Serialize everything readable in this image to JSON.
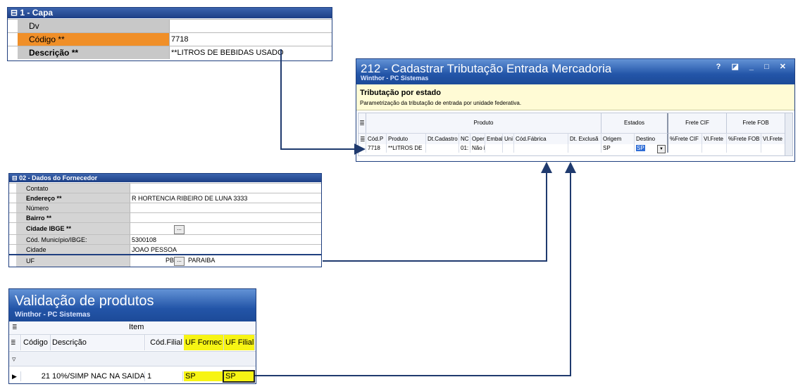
{
  "capa": {
    "header": "1 - Capa",
    "rows": [
      {
        "label": "Dv",
        "value": ""
      },
      {
        "label": "Código **",
        "value": "7718"
      },
      {
        "label": "Descrição **",
        "value": "**LITROS DE BEBIDAS USADO"
      }
    ]
  },
  "tributacao": {
    "title": "212 - Cadastrar Tributação Entrada Mercadoria",
    "subtitle": "Winthor - PC Sistemas",
    "window_controls": "? ◪ _ □ ✕",
    "section_title": "Tributação por estado",
    "section_desc": "Parametrização da tributação de entrada por unidade federativa.",
    "bands": {
      "produto": "Produto",
      "estados": "Estados",
      "frete_cif": "Frete CIF",
      "frete_fob": "Frete FOB"
    },
    "columns": [
      "Cód.P",
      "Produto",
      "Dt.Cadastro",
      "NC",
      "Oper",
      "Embal",
      "Uni",
      "Cód.Fábrica",
      "Dt. Exclusã",
      "Origem",
      "Destino",
      "%Frete CIF",
      "Vl.Frete",
      "%Frete FOB",
      "Vl.Frete"
    ],
    "row": [
      "7718",
      "**LITROS DE",
      "",
      "01:",
      "Não i",
      "",
      "",
      "",
      "",
      "SP",
      "SP",
      "",
      "",
      "",
      ""
    ]
  },
  "fornecedor": {
    "header": "02 - Dados do Fornecedor",
    "rows": [
      {
        "label": "Contato",
        "value": ""
      },
      {
        "label": "Endereço **",
        "value": "R HORTENCIA RIBEIRO DE LUNA 3333"
      },
      {
        "label": "Número",
        "value": ""
      },
      {
        "label": "Bairro **",
        "value": ""
      },
      {
        "label": "Cidade IBGE **",
        "value": ""
      },
      {
        "label": "Cód. Município/IBGE:",
        "value": "5300108"
      },
      {
        "label": "Cidade",
        "value": "JOAO PESSOA"
      },
      {
        "label": "UF",
        "value": "PB"
      }
    ],
    "uf_name": "PARAIBA",
    "lookup_label": "..."
  },
  "validacao": {
    "title": "Validação de produtos",
    "subtitle": "Winthor - PC Sistemas",
    "band": "Item",
    "columns": [
      "Código",
      "Descrição",
      "Cód.Filial",
      "UF Fornec",
      "UF Filial"
    ],
    "row": [
      "21",
      "10%/SIMP NAC NA SAIDA",
      "1",
      "SP",
      "SP"
    ]
  },
  "colors": {
    "accent_orange": "#f08f28",
    "highlight_yellow": "#f7f414",
    "title_blue": "#2355a8",
    "connector": "#1f3a6e"
  }
}
